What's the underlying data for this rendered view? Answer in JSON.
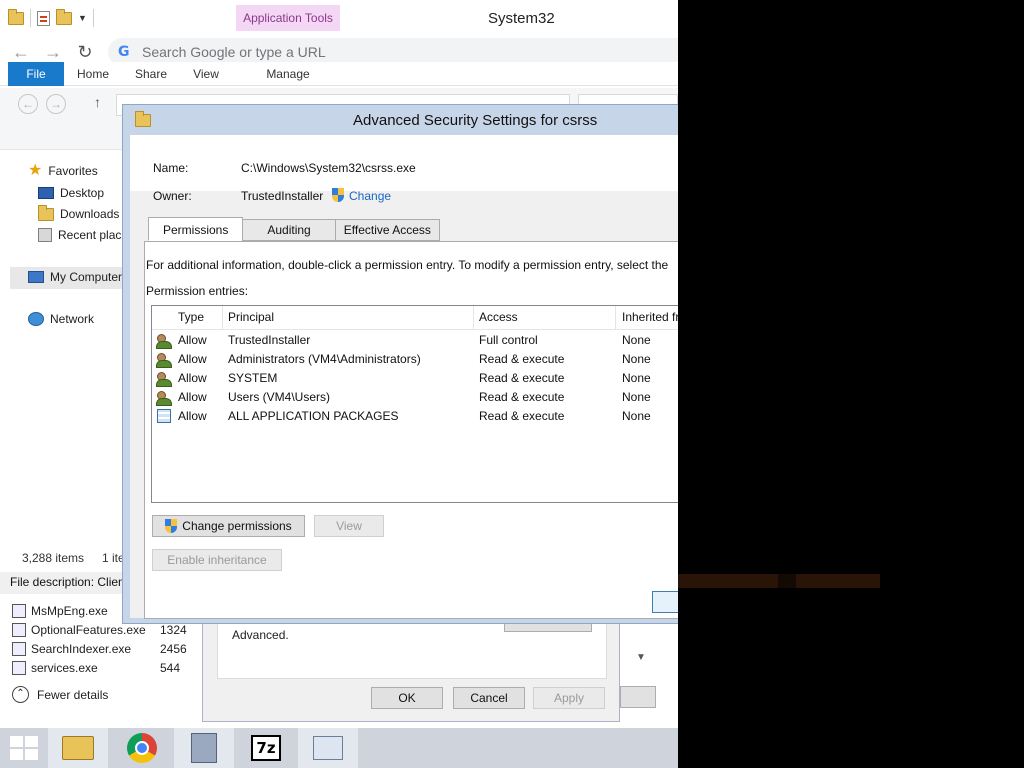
{
  "explorer": {
    "window_title": "System32",
    "app_tools_label": "Application Tools",
    "search_placeholder": "Search Google or type a URL",
    "ribbon_tabs": [
      "File",
      "Home",
      "Share",
      "View",
      "Manage"
    ],
    "nav_pane": [
      "Favorites",
      "Desktop",
      "Downloads",
      "Recent plac",
      "My Computer",
      "Network"
    ],
    "status_items": "3,288 items",
    "status_selected": "1 ite",
    "file_description": "File description: Clien"
  },
  "task_manager": {
    "processes": [
      {
        "name": "MsMpEng.exe",
        "pid": ""
      },
      {
        "name": "OptionalFeatures.exe",
        "pid": "1324"
      },
      {
        "name": "SearchIndexer.exe",
        "pid": "2456"
      },
      {
        "name": "services.exe",
        "pid": "544"
      }
    ],
    "fewer_details": "Fewer details"
  },
  "properties_dialog": {
    "advanced_text": "Advanced.",
    "ok": "OK",
    "cancel": "Cancel",
    "apply": "Apply"
  },
  "advanced_security": {
    "title": "Advanced Security Settings for csrss",
    "name_label": "Name:",
    "name_value": "C:\\Windows\\System32\\csrss.exe",
    "owner_label": "Owner:",
    "owner_value": "TrustedInstaller",
    "change_link": "Change",
    "tabs": [
      "Permissions",
      "Auditing",
      "Effective Access"
    ],
    "info_text": "For additional information, double-click a permission entry. To modify a permission entry, select the",
    "entries_label": "Permission entries:",
    "columns": [
      "Type",
      "Principal",
      "Access",
      "Inherited fr"
    ],
    "entries": [
      {
        "type": "Allow",
        "principal": "TrustedInstaller",
        "access": "Full control",
        "inherited": "None",
        "icon": "user-group-icon"
      },
      {
        "type": "Allow",
        "principal": "Administrators (VM4\\Administrators)",
        "access": "Read & execute",
        "inherited": "None",
        "icon": "user-group-icon"
      },
      {
        "type": "Allow",
        "principal": "SYSTEM",
        "access": "Read & execute",
        "inherited": "None",
        "icon": "user-group-icon"
      },
      {
        "type": "Allow",
        "principal": "Users (VM4\\Users)",
        "access": "Read & execute",
        "inherited": "None",
        "icon": "user-group-icon"
      },
      {
        "type": "Allow",
        "principal": "ALL APPLICATION PACKAGES",
        "access": "Read & execute",
        "inherited": "None",
        "icon": "app-package-icon"
      }
    ],
    "change_permissions_btn": "Change permissions",
    "view_btn": "View",
    "enable_inheritance_btn": "Enable inheritance"
  },
  "taskbar": {
    "items": [
      "start-icon",
      "file-explorer-icon",
      "chrome-icon",
      "setup-icon",
      "7zip-icon",
      "performance-monitor-icon"
    ],
    "sevenz_label": "7z"
  },
  "colors": {
    "accent_blue": "#1979ca",
    "app_tools_bg": "#f4d7f4",
    "dialog_frame": "#c7d5e8",
    "link_blue": "#1a66c2"
  }
}
